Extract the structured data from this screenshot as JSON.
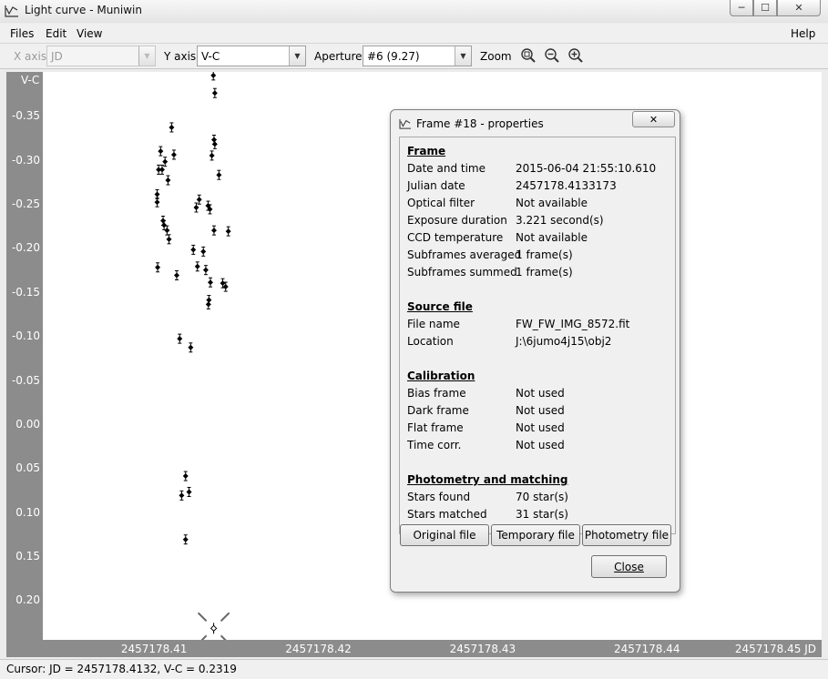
{
  "window": {
    "title": "Light curve - Muniwin",
    "min_label": "─",
    "max_label": "☐",
    "close_label": "✕"
  },
  "menu": {
    "files": "Files",
    "edit": "Edit",
    "view": "View",
    "help": "Help"
  },
  "toolbar": {
    "x_axis_label": "X axis",
    "x_axis_value": "JD",
    "y_axis_label": "Y axis",
    "y_axis_value": "V-C",
    "aperture_label": "Aperture",
    "aperture_value": "#6 (9.27)",
    "zoom_label": "Zoom"
  },
  "chart_data": {
    "type": "scatter",
    "ylabel": "V-C",
    "xlabel": "JD",
    "y_ticks": [
      "-0.35",
      "-0.30",
      "-0.25",
      "-0.20",
      "-0.15",
      "-0.10",
      "-0.05",
      "0.00",
      "0.05",
      "0.10",
      "0.15",
      "0.20"
    ],
    "x_ticks": [
      "2457178.41",
      "2457178.42",
      "2457178.43",
      "2457178.44",
      "2457178.45 JD"
    ],
    "y_inverted": true,
    "ylim": [
      -0.4,
      0.245
    ],
    "xlim": [
      2457178.4028,
      2457178.4502
    ],
    "points": [
      {
        "x": 2457178.41318,
        "y": -0.396
      },
      {
        "x": 2457178.41327,
        "y": -0.376
      },
      {
        "x": 2457178.41064,
        "y": -0.337
      },
      {
        "x": 2457178.41322,
        "y": -0.323
      },
      {
        "x": 2457178.41327,
        "y": -0.318
      },
      {
        "x": 2457178.40997,
        "y": -0.31
      },
      {
        "x": 2457178.41309,
        "y": -0.305
      },
      {
        "x": 2457178.41078,
        "y": -0.306
      },
      {
        "x": 2457178.41024,
        "y": -0.298
      },
      {
        "x": 2457178.40985,
        "y": -0.289
      },
      {
        "x": 2457178.41006,
        "y": -0.289
      },
      {
        "x": 2457178.41352,
        "y": -0.283
      },
      {
        "x": 2457178.41042,
        "y": -0.277
      },
      {
        "x": 2457178.40976,
        "y": -0.261
      },
      {
        "x": 2457178.41232,
        "y": -0.255
      },
      {
        "x": 2457178.40976,
        "y": -0.252
      },
      {
        "x": 2457178.41286,
        "y": -0.248
      },
      {
        "x": 2457178.41214,
        "y": -0.246
      },
      {
        "x": 2457178.41297,
        "y": -0.244
      },
      {
        "x": 2457178.41012,
        "y": -0.231
      },
      {
        "x": 2457178.41018,
        "y": -0.226
      },
      {
        "x": 2457178.41036,
        "y": -0.22
      },
      {
        "x": 2457178.41322,
        "y": -0.22
      },
      {
        "x": 2457178.41409,
        "y": -0.219
      },
      {
        "x": 2457178.41048,
        "y": -0.21
      },
      {
        "x": 2457178.41196,
        "y": -0.198
      },
      {
        "x": 2457178.41257,
        "y": -0.196
      },
      {
        "x": 2457178.40979,
        "y": -0.178
      },
      {
        "x": 2457178.41221,
        "y": -0.179
      },
      {
        "x": 2457178.41272,
        "y": -0.175
      },
      {
        "x": 2457178.41095,
        "y": -0.169
      },
      {
        "x": 2457178.413,
        "y": -0.161
      },
      {
        "x": 2457178.41375,
        "y": -0.16
      },
      {
        "x": 2457178.41393,
        "y": -0.156
      },
      {
        "x": 2457178.41291,
        "y": -0.141
      },
      {
        "x": 2457178.41288,
        "y": -0.136
      },
      {
        "x": 2457178.41113,
        "y": -0.097
      },
      {
        "x": 2457178.4118,
        "y": -0.087
      },
      {
        "x": 2457178.41149,
        "y": 0.059
      },
      {
        "x": 2457178.4117,
        "y": 0.077
      },
      {
        "x": 2457178.41125,
        "y": 0.081
      },
      {
        "x": 2457178.41149,
        "y": 0.131
      }
    ],
    "cursor_point": {
      "x": 2457178.4132,
      "y": 0.2319
    }
  },
  "status": {
    "cursor_text": "Cursor: JD = 2457178.4132, V-C = 0.2319"
  },
  "dialog": {
    "title": "Frame #18 - properties",
    "close_label": "✕",
    "sections": {
      "frame": "Frame",
      "source": "Source file",
      "calibration": "Calibration",
      "photometry": "Photometry and matching"
    },
    "frame_rows": [
      {
        "label": "Date and time",
        "value": "2015-06-04 21:55:10.610"
      },
      {
        "label": "Julian date",
        "value": "2457178.4133173"
      },
      {
        "label": "Optical filter",
        "value": "Not available"
      },
      {
        "label": "Exposure duration",
        "value": "3.221 second(s)"
      },
      {
        "label": "CCD temperature",
        "value": "Not available"
      },
      {
        "label": "Subframes averaged",
        "value": "1 frame(s)"
      },
      {
        "label": "Subframes summed",
        "value": "1 frame(s)"
      }
    ],
    "source_rows": [
      {
        "label": "File name",
        "value": "FW_FW_IMG_8572.fit"
      },
      {
        "label": "Location",
        "value": "J:\\6jumo4j15\\obj2"
      }
    ],
    "calib_rows": [
      {
        "label": "Bias frame",
        "value": "Not used"
      },
      {
        "label": "Dark frame",
        "value": "Not used"
      },
      {
        "label": "Flat frame",
        "value": "Not used"
      },
      {
        "label": "Time corr.",
        "value": "Not used"
      }
    ],
    "phot_rows": [
      {
        "label": "Stars found",
        "value": "70 star(s)"
      },
      {
        "label": "Stars matched",
        "value": "31 star(s)"
      }
    ],
    "buttons": {
      "original": "Original file",
      "temporary": "Temporary file",
      "photometry": "Photometry file",
      "close": "Close"
    }
  }
}
